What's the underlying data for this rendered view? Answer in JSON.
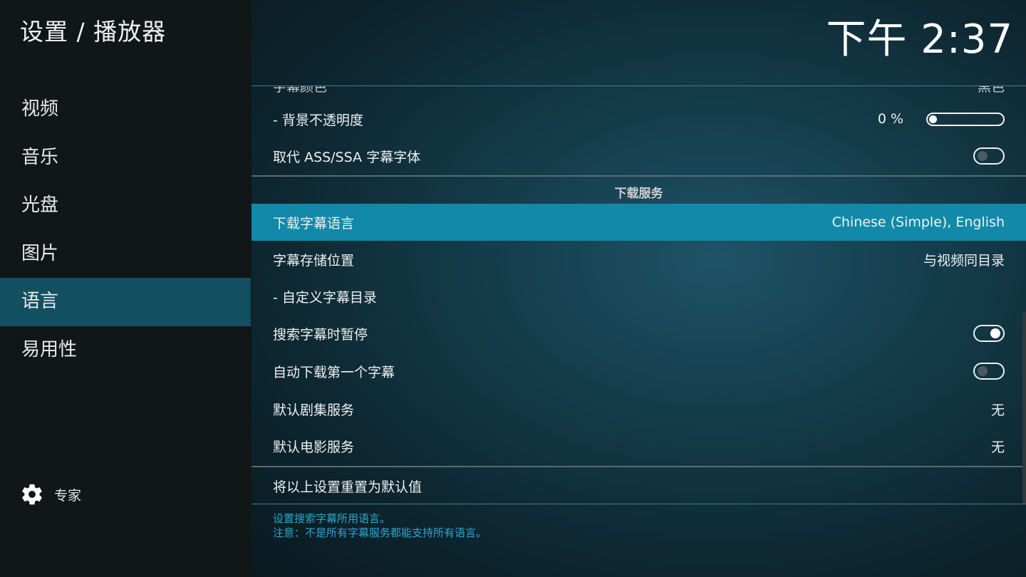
{
  "header": {
    "page_title": "设置 / 播放器",
    "clock": "下午 2:37"
  },
  "sidebar": {
    "items": [
      {
        "label": "视频"
      },
      {
        "label": "音乐"
      },
      {
        "label": "光盘"
      },
      {
        "label": "图片"
      },
      {
        "label": "语言",
        "active": true
      },
      {
        "label": "易用性"
      }
    ],
    "expert_label": "专家",
    "expert_icon": "gear-icon"
  },
  "settings": {
    "clipped_row": {
      "label": "字幕颜色",
      "value": "黑色"
    },
    "bg_opacity": {
      "label": "- 背景不透明度",
      "value": "0 %",
      "level_percent": 0
    },
    "override_ass": {
      "label": "取代 ASS/SSA 字幕字体",
      "state": "off"
    },
    "group_title": "下载服务",
    "download_lang": {
      "label": "下载字幕语言",
      "value": "Chinese (Simple), English"
    },
    "storage_location": {
      "label": "字幕存储位置",
      "value": "与视频同目录"
    },
    "custom_folder": {
      "label": "- 自定义字幕目录"
    },
    "pause_search": {
      "label": "搜索字幕时暂停",
      "state": "on"
    },
    "auto_download": {
      "label": "自动下载第一个字幕",
      "state": "off"
    },
    "default_tv": {
      "label": "默认剧集服务",
      "value": "无"
    },
    "default_movie": {
      "label": "默认电影服务",
      "value": "无"
    },
    "reset": {
      "label": "将以上设置重置为默认值"
    }
  },
  "help": {
    "line1": "设置搜索字幕所用语言。",
    "line2": "注意：不是所有字幕服务都能支持所有语言。"
  },
  "colors": {
    "focus": "#1289a9",
    "active_nav": "#124f60",
    "help_text": "#2ea6d0"
  }
}
